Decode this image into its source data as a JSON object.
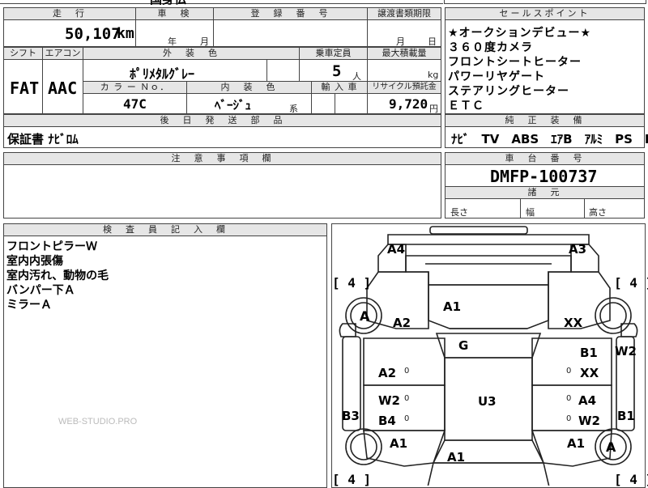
{
  "top_fragment": "国身仏",
  "mileage": {
    "header": "走　行",
    "value": "50,107",
    "unit": "km"
  },
  "inspection": {
    "header": "車　検",
    "year": "年",
    "month": "月"
  },
  "registration": {
    "header": "登　録　番　号"
  },
  "transfer": {
    "header": "譲渡書類期限",
    "month": "月",
    "day": "日"
  },
  "shift": {
    "header": "シフト",
    "value": "FAT"
  },
  "aircon": {
    "header": "エアコン",
    "value": "AAC"
  },
  "exterior_color": {
    "header": "外　装　色",
    "value": "ﾎﾟﾘﾒﾀﾙｸﾞﾚｰ"
  },
  "capacity": {
    "header": "乗車定員",
    "value": "5",
    "unit": "人"
  },
  "max_load": {
    "header": "最大積載量",
    "unit": "kg"
  },
  "color_no": {
    "header": "カ ラ ー Ｎｏ．",
    "value": "47C"
  },
  "interior_color": {
    "header": "内　装　色",
    "value": "ﾍﾞｰｼﾞｭ",
    "suffix": "系"
  },
  "import": {
    "header": "輸 入 車"
  },
  "recycle": {
    "header": "リサイクル預託金",
    "value": "9,720",
    "unit": "円"
  },
  "later_parts": {
    "header": "後　日　発　送　部　品",
    "value": "保証書 ﾅﾋﾞﾛﾑ"
  },
  "notes": {
    "header": "注　意　事　項　欄"
  },
  "sales_points": {
    "header": "セールスポイント",
    "items": [
      "★オークションデビュー★",
      "３６０度カメラ",
      "フロントシートヒーター",
      "パワーリヤゲート",
      "ステアリングヒーター",
      "ＥＴＣ"
    ]
  },
  "equipment": {
    "header": "純　正　装　備",
    "value": "ﾅﾋﾞ　TV　ABS　ｴｱB　ｱﾙﾐ　PS　PW"
  },
  "chassis": {
    "header": "車　台　番　号",
    "value": "DMFP-100737"
  },
  "specs": {
    "header": "諸　元",
    "length": "長さ",
    "width": "幅",
    "height": "高さ"
  },
  "inspector": {
    "header": "検　査　員　記　入　欄",
    "items": [
      "フロントピラーＷ",
      "室内内張傷",
      "室内汚れ、動物の毛",
      "バンパー下Ａ",
      "ミラーＡ"
    ]
  },
  "watermark": "WEB-STUDIO.PRO",
  "diagram": {
    "tyre_fl": "[ 4 ]",
    "tyre_fr": "[ 4 ]",
    "tyre_rl": "[ 4 ]",
    "tyre_rr": "[ 4 ]",
    "wheel_fl": "A",
    "wheel_rr": "A",
    "marks": {
      "front_left_corner": "A4",
      "front_right_corner": "A3",
      "hood": "A1",
      "fender_fl": "A2",
      "fender_fr": "XX",
      "windshield": "G",
      "door_fr_top": "B1",
      "pillar_r": "W2",
      "door_fl": "A2",
      "door_fr": "XX",
      "roof": "U3",
      "door_rl_w": "W2",
      "door_rl_b": "B4",
      "door_rr_a": "A4",
      "door_rr_w": "W2",
      "side_l": "B3",
      "side_r": "B1",
      "quarter_rl": "A1",
      "quarter_rr": "A1",
      "trunk": "A1",
      "dent_1": "0",
      "dent_2": "0",
      "dent_3": "0",
      "dent_4": "0",
      "dent_5": "0",
      "dent_6": "0"
    }
  }
}
